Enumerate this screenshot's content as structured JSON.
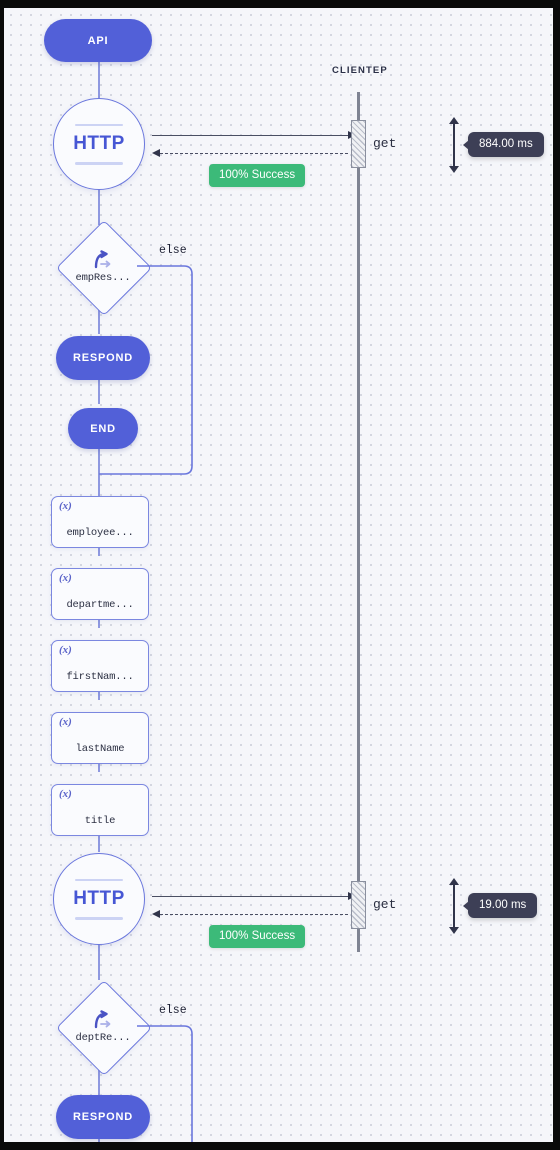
{
  "canvas": {
    "background_color": "#f5f6fa",
    "dot_color": "#c9ccd8",
    "frame_color": "#0a0a0a"
  },
  "theme": {
    "primary": "#5260d8",
    "node_border": "#6a77dd",
    "flow_line": "#8e98e0",
    "success_green": "#3cba79",
    "tooltip_dark": "#3d3f56",
    "lifeline_gray": "#7f8493",
    "arrow_dark": "#30344a"
  },
  "lifeline": {
    "name": "CLIENTEP"
  },
  "flow": {
    "start": {
      "label": "API",
      "type": "start-pill"
    },
    "nodes": [
      {
        "id": "http1",
        "type": "http-circle",
        "label": "HTTP"
      },
      {
        "id": "cond1",
        "type": "decision",
        "label": "empRes...",
        "icon": "branch-icon",
        "else_label": "else"
      },
      {
        "id": "respond1",
        "type": "respond-pill",
        "label": "RESPOND"
      },
      {
        "id": "end1",
        "type": "end-pill",
        "label": "END"
      },
      {
        "id": "var1",
        "type": "variable",
        "icon": "(x)",
        "label": "employee..."
      },
      {
        "id": "var2",
        "type": "variable",
        "icon": "(x)",
        "label": "departme..."
      },
      {
        "id": "var3",
        "type": "variable",
        "icon": "(x)",
        "label": "firstNam..."
      },
      {
        "id": "var4",
        "type": "variable",
        "icon": "(x)",
        "label": "lastName"
      },
      {
        "id": "var5",
        "type": "variable",
        "icon": "(x)",
        "label": "title"
      },
      {
        "id": "http2",
        "type": "http-circle",
        "label": "HTTP"
      },
      {
        "id": "cond2",
        "type": "decision",
        "label": "deptRe...",
        "icon": "branch-icon",
        "else_label": "else"
      },
      {
        "id": "respond2",
        "type": "respond-pill",
        "label": "RESPOND"
      }
    ]
  },
  "interactions": [
    {
      "id": "call1",
      "operation": "get",
      "success_badge": "100% Success",
      "duration": "884.00 ms"
    },
    {
      "id": "call2",
      "operation": "get",
      "success_badge": "100% Success",
      "duration": "19.00 ms"
    }
  ]
}
